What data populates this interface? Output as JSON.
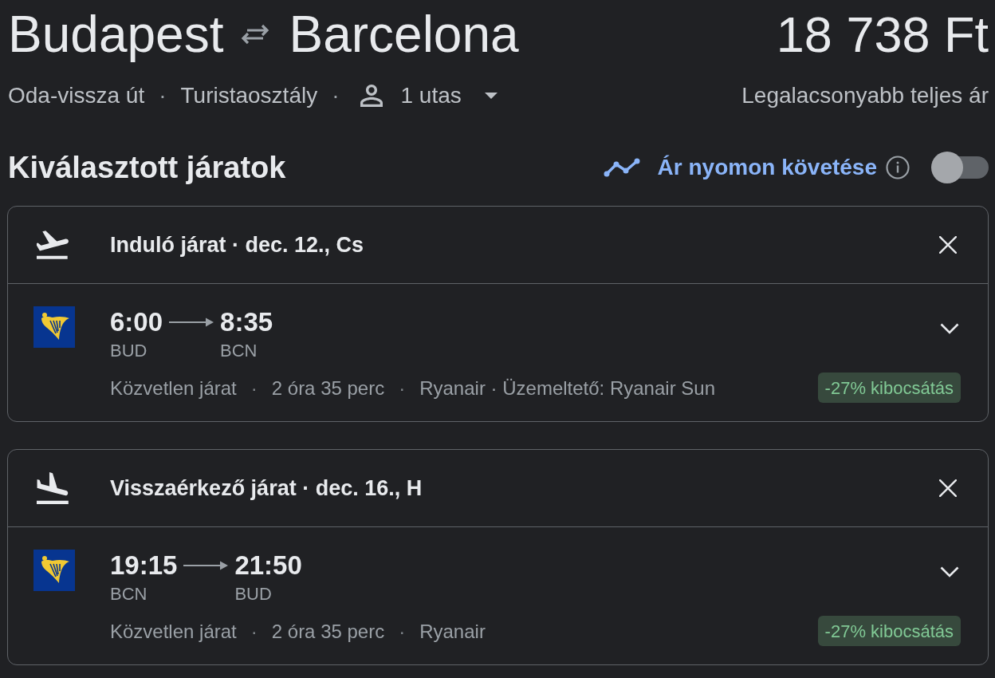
{
  "route": {
    "origin": "Budapest",
    "destination": "Barcelona"
  },
  "price": {
    "amount": "18 738 Ft",
    "note": "Legalacsonyabb teljes ár"
  },
  "trip_summary": [
    {
      "kind": "text",
      "text": "Oda-vissza út"
    },
    {
      "kind": "separator",
      "text": "·"
    },
    {
      "kind": "text",
      "text": "Turistaosztály"
    },
    {
      "kind": "separator",
      "text": "·"
    }
  ],
  "passengers": {
    "label": "1 utas"
  },
  "selected_flights": {
    "title": "Kiválasztott járatok",
    "price_tracking": {
      "label": "Ár nyomon követése",
      "on": false
    }
  },
  "flights": [
    {
      "kind": "departure",
      "title": "Induló járat · dec. 12., Cs",
      "departure_time": "6:00",
      "departure_airport": "BUD",
      "arrival_time": "8:35",
      "arrival_airport": "BCN",
      "details": [
        {
          "kind": "text",
          "text": "Közvetlen járat"
        },
        {
          "kind": "separator",
          "text": "·"
        },
        {
          "kind": "text",
          "text": "2 óra 35 perc"
        },
        {
          "kind": "separator",
          "text": "·"
        },
        {
          "kind": "text",
          "text": "Ryanair · Üzemeltető: Ryanair Sun"
        }
      ],
      "emissions": "-27% kibocsátás",
      "expanded": false
    },
    {
      "kind": "return",
      "title": "Visszaérkező járat · dec. 16., H",
      "departure_time": "19:15",
      "departure_airport": "BCN",
      "arrival_time": "21:50",
      "arrival_airport": "BUD",
      "details": [
        {
          "kind": "text",
          "text": "Közvetlen járat"
        },
        {
          "kind": "separator",
          "text": "·"
        },
        {
          "kind": "text",
          "text": "2 óra 35 perc"
        },
        {
          "kind": "separator",
          "text": "·"
        },
        {
          "kind": "text",
          "text": "Ryanair"
        }
      ],
      "emissions": "-27% kibocsátás",
      "expanded": false
    }
  ]
}
